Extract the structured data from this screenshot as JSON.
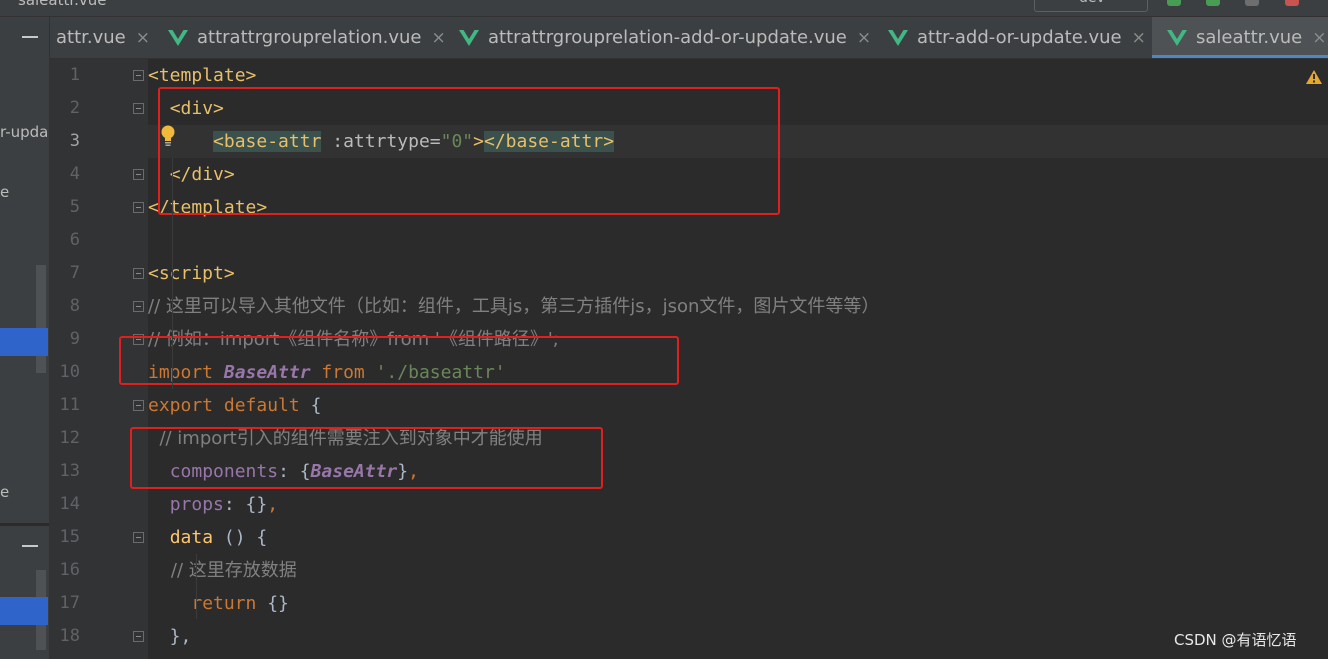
{
  "window": {
    "top_title": "saleattr.vue",
    "run_config_label": "dev"
  },
  "project_panel": {
    "fragments": [
      "r-upda",
      "e",
      "e"
    ]
  },
  "tabs": [
    {
      "label": "attr.vue",
      "icon": "vue-icon",
      "active": false
    },
    {
      "label": "attrattrgrouprelation.vue",
      "icon": "vue-icon",
      "active": false
    },
    {
      "label": "attrattrgrouprelation-add-or-update.vue",
      "icon": "vue-icon",
      "active": false
    },
    {
      "label": "attr-add-or-update.vue",
      "icon": "vue-icon",
      "active": false
    },
    {
      "label": "saleattr.vue",
      "icon": "vue-icon",
      "active": true
    }
  ],
  "tab_close_glyph": "×",
  "editor": {
    "current_line": 3,
    "line_numbers": [
      "1",
      "2",
      "3",
      "4",
      "5",
      "6",
      "7",
      "8",
      "9",
      "10",
      "11",
      "12",
      "13",
      "14",
      "15",
      "16",
      "17",
      "18"
    ],
    "lines": [
      {
        "num": "1",
        "tokens": [
          {
            "t": "<template>",
            "c": "tag"
          }
        ]
      },
      {
        "num": "2",
        "tokens": [
          {
            "t": "  ",
            "c": "plain"
          },
          {
            "t": "<div>",
            "c": "tag"
          }
        ]
      },
      {
        "num": "3",
        "tokens": [
          {
            "t": "      ",
            "c": "plain"
          },
          {
            "t": "<base-attr",
            "c": "tag match"
          },
          {
            "t": " :attrtype=",
            "c": "attr"
          },
          {
            "t": "\"0\"",
            "c": "str"
          },
          {
            "t": ">",
            "c": "tag"
          },
          {
            "t": "</base-attr>",
            "c": "tag match"
          }
        ]
      },
      {
        "num": "4",
        "tokens": [
          {
            "t": "  ",
            "c": "plain"
          },
          {
            "t": "</div>",
            "c": "tag"
          }
        ]
      },
      {
        "num": "5",
        "tokens": [
          {
            "t": "</template>",
            "c": "tag"
          }
        ]
      },
      {
        "num": "6",
        "tokens": []
      },
      {
        "num": "7",
        "tokens": [
          {
            "t": "<script>",
            "c": "tag"
          }
        ]
      },
      {
        "num": "8",
        "tokens": [
          {
            "t": "// 这里可以导入其他文件（比如：组件，工具js，第三方插件js，json文件，图片文件等等）",
            "c": "cmt"
          }
        ]
      },
      {
        "num": "9",
        "tokens": [
          {
            "t": "// 例如：import《组件名称》from '《组件路径》';",
            "c": "cmt"
          }
        ]
      },
      {
        "num": "10",
        "tokens": [
          {
            "t": "import ",
            "c": "kw"
          },
          {
            "t": "BaseAttr",
            "c": "comp"
          },
          {
            "t": " from ",
            "c": "kw"
          },
          {
            "t": "'./baseattr'",
            "c": "str"
          }
        ]
      },
      {
        "num": "11",
        "tokens": [
          {
            "t": "export default ",
            "c": "kw"
          },
          {
            "t": "{",
            "c": "plain"
          }
        ]
      },
      {
        "num": "12",
        "tokens": [
          {
            "t": "  // import引入的组件需要注入到对象中才能使用",
            "c": "cmt"
          }
        ]
      },
      {
        "num": "13",
        "tokens": [
          {
            "t": "  ",
            "c": "plain"
          },
          {
            "t": "components",
            "c": "prop"
          },
          {
            "t": ": {",
            "c": "plain"
          },
          {
            "t": "BaseAttr",
            "c": "comp"
          },
          {
            "t": "}",
            "c": "plain"
          },
          {
            "t": ",",
            "c": "kw"
          }
        ]
      },
      {
        "num": "14",
        "tokens": [
          {
            "t": "  ",
            "c": "plain"
          },
          {
            "t": "props",
            "c": "prop"
          },
          {
            "t": ": {}",
            "c": "plain"
          },
          {
            "t": ",",
            "c": "kw"
          }
        ]
      },
      {
        "num": "15",
        "tokens": [
          {
            "t": "  ",
            "c": "plain"
          },
          {
            "t": "data",
            "c": "fn"
          },
          {
            "t": " () {",
            "c": "plain"
          }
        ]
      },
      {
        "num": "16",
        "tokens": [
          {
            "t": "    // 这里存放数据",
            "c": "cmt"
          }
        ]
      },
      {
        "num": "17",
        "tokens": [
          {
            "t": "    ",
            "c": "plain"
          },
          {
            "t": "return ",
            "c": "kw"
          },
          {
            "t": "{}",
            "c": "plain"
          }
        ]
      },
      {
        "num": "18",
        "tokens": [
          {
            "t": "  },",
            "c": "plain"
          }
        ]
      }
    ]
  },
  "colors": {
    "red_box": "#e0201d",
    "vue_icon": "#41b883",
    "active_tab_underline": "#4a88c7",
    "warning": "#e5a82f",
    "bulb": "#f0b93a"
  },
  "watermark": "CSDN @有语忆语"
}
